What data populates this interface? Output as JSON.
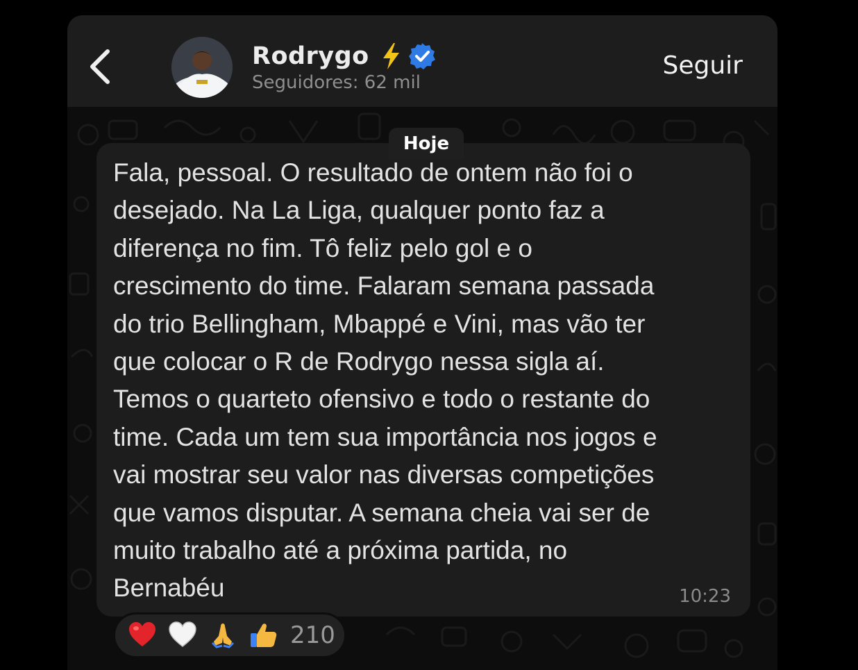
{
  "header": {
    "channel_name": "Rodrygo",
    "followers": "Seguidores: 62 mil",
    "follow_label": "Seguir",
    "name_icons": [
      "lightning-bolt",
      "verified-badge"
    ]
  },
  "chat": {
    "date_label": "Hoje",
    "message": {
      "lines": [
        "Fala, pessoal. O resultado de ontem não foi o",
        "desejado. Na La Liga, qualquer ponto faz a",
        "diferença no fim. Tô feliz pelo gol e o",
        "crescimento do time. Falaram semana passada",
        "do trio Bellingham, Mbappé e Vini, mas vão ter",
        "que colocar o R de Rodrygo nessa sigla aí.",
        "Temos o quarteto ofensivo e todo o restante do",
        "time. Cada um tem sua importância nos jogos e",
        "vai mostrar seu valor nas diversas competições",
        "que vamos disputar. A semana cheia vai ser de",
        "muito trabalho até a próxima partida, no",
        "Bernabéu"
      ],
      "time": "10:23"
    },
    "reactions": {
      "emojis": [
        "red-heart",
        "white-heart",
        "folded-hands",
        "thumbs-up"
      ],
      "count": "210"
    }
  },
  "colors": {
    "background": "#000000",
    "header": "#1d1d1d",
    "bubble": "#1d1d1d",
    "verified": "#2f7be5",
    "bolt": "#f2c319"
  }
}
